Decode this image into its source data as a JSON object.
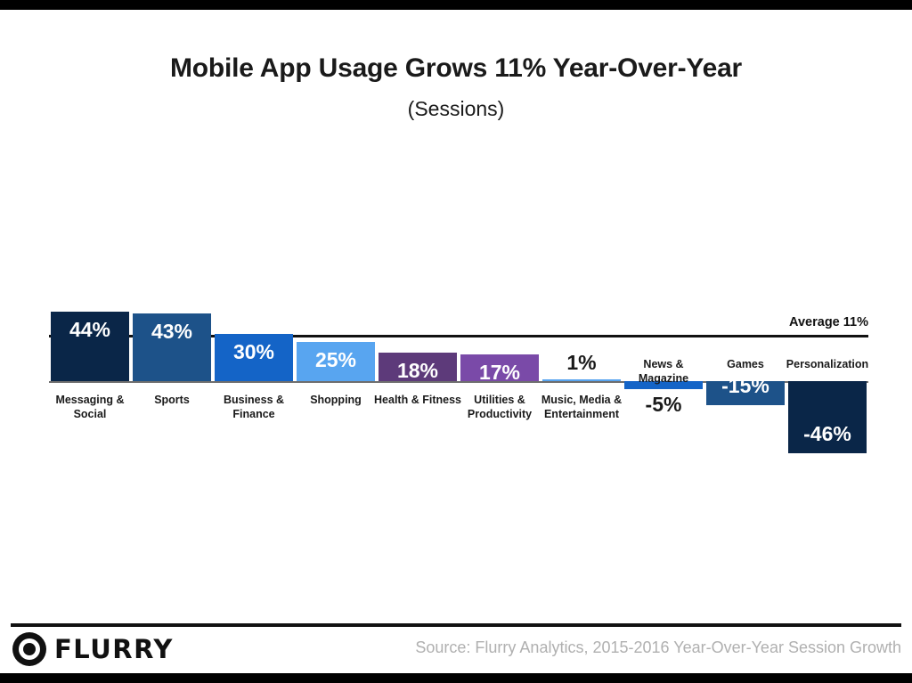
{
  "header": {
    "title": "Mobile App Usage Grows 11% Year-Over-Year",
    "subtitle": "(Sessions)"
  },
  "annotations": {
    "average_label": "Average 11%"
  },
  "footer": {
    "logo_text": "FLURRY",
    "logo_icon": "flurry-circle-icon",
    "source": "Source: Flurry Analytics, 2015-2016 Year-Over-Year Session Growth"
  },
  "chart_data": {
    "type": "bar",
    "title": "Mobile App Usage Grows 11% Year-Over-Year",
    "subtitle": "(Sessions)",
    "xlabel": "",
    "ylabel": "",
    "ylim": [
      -46,
      44
    ],
    "grid": false,
    "legend": "none",
    "average_line": 11,
    "average_line_label": "Average 11%",
    "value_suffix": "%",
    "categories": [
      "Messaging & Social",
      "Sports",
      "Business & Finance",
      "Shopping",
      "Health & Fitness",
      "Utilities & Productivity",
      "Music, Media & Entertainment",
      "News & Magazine",
      "Games",
      "Personalization"
    ],
    "values": [
      44,
      43,
      30,
      25,
      18,
      17,
      1,
      -5,
      -15,
      -46
    ],
    "labels": [
      "44%",
      "43%",
      "30%",
      "25%",
      "18%",
      "17%",
      "1%",
      "-5%",
      "-15%",
      "-46%"
    ],
    "colors": [
      "#0a2648",
      "#1d5289",
      "#1464c7",
      "#58a5f0",
      "#5d3a7a",
      "#7a4aa8",
      "#58a5f0",
      "#1464c7",
      "#1d5289",
      "#0a2648"
    ],
    "label_placement": [
      "inside",
      "inside",
      "inside",
      "inside",
      "inside",
      "inside",
      "outside",
      "outside",
      "inside",
      "inside"
    ],
    "source": "Source: Flurry Analytics, 2015-2016 Year-Over-Year Session Growth"
  }
}
